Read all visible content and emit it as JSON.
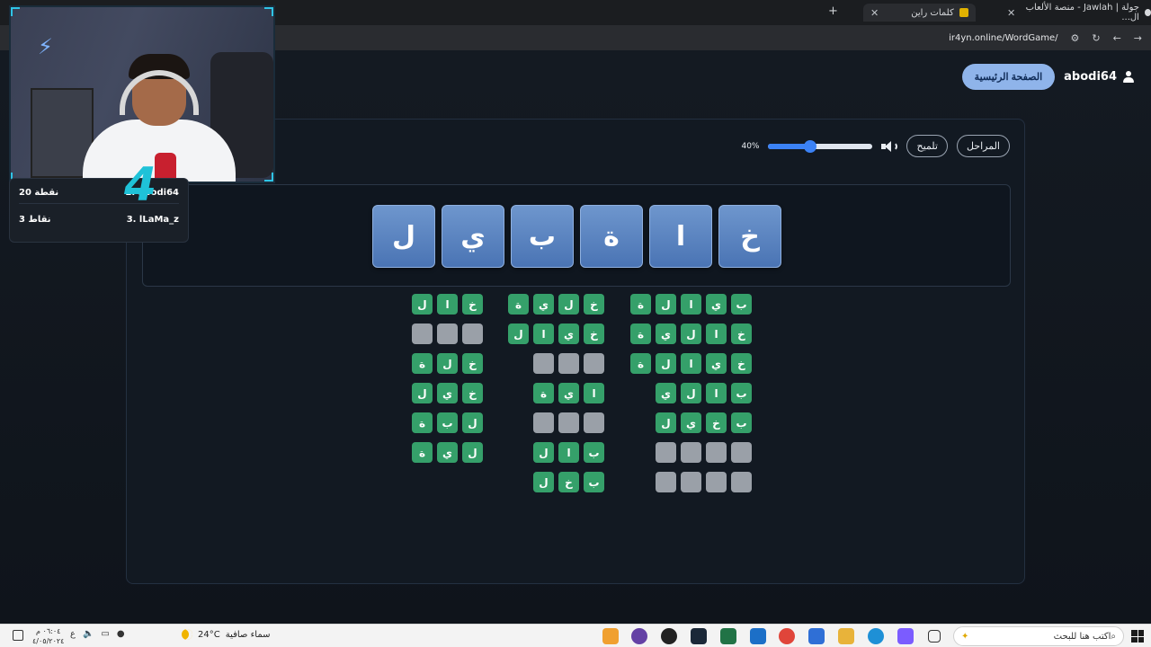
{
  "browser": {
    "tabs": [
      {
        "title": "جولة | Jawlah - منصة الألعاب ال...",
        "active": false
      },
      {
        "title": "كلمات راين",
        "active": true
      }
    ],
    "new_tab": "+",
    "url": "ir4yn.online/WordGame/"
  },
  "header": {
    "username": "abodi64",
    "home_button": "الصفحة الرئيسية"
  },
  "controls": {
    "stages_button": "المراحل",
    "hint_button": "تلميح",
    "volume_percent": 40,
    "volume_label": "40%"
  },
  "letters": [
    "خ",
    "ا",
    "ة",
    "ب",
    "ي",
    "ل"
  ],
  "word_columns": [
    [
      {
        "letters": [
          "ب",
          "ي",
          "ا",
          "ل",
          "ة"
        ],
        "found": true
      },
      {
        "letters": [
          "خ",
          "ا",
          "ل",
          "ي",
          "ة"
        ],
        "found": true
      },
      {
        "letters": [
          "خ",
          "ي",
          "ا",
          "ل",
          "ة"
        ],
        "found": true
      },
      {
        "letters": [
          "ب",
          "ا",
          "ل",
          "ي"
        ],
        "found": true
      },
      {
        "letters": [
          "ب",
          "خ",
          "ي",
          "ل"
        ],
        "found": true
      },
      {
        "letters": [
          "",
          "",
          "",
          ""
        ],
        "found": false
      },
      {
        "letters": [
          "",
          "",
          "",
          ""
        ],
        "found": false
      }
    ],
    [
      {
        "letters": [
          "خ",
          "ل",
          "ي",
          "ة"
        ],
        "found": true
      },
      {
        "letters": [
          "خ",
          "ي",
          "ا",
          "ل"
        ],
        "found": true
      },
      {
        "letters": [
          "",
          "",
          ""
        ],
        "found": false
      },
      {
        "letters": [
          "ا",
          "ي",
          "ة"
        ],
        "found": true
      },
      {
        "letters": [
          "",
          "",
          ""
        ],
        "found": false
      },
      {
        "letters": [
          "ب",
          "ا",
          "ل"
        ],
        "found": true
      },
      {
        "letters": [
          "ب",
          "خ",
          "ل"
        ],
        "found": true
      }
    ],
    [
      {
        "letters": [
          "خ",
          "ا",
          "ل"
        ],
        "found": true
      },
      {
        "letters": [
          "",
          "",
          ""
        ],
        "found": false
      },
      {
        "letters": [
          "خ",
          "ل",
          "ة"
        ],
        "found": true
      },
      {
        "letters": [
          "خ",
          "ي",
          "ل"
        ],
        "found": true
      },
      {
        "letters": [
          "ل",
          "ب",
          "ة"
        ],
        "found": true
      },
      {
        "letters": [
          "ل",
          "ي",
          "ة"
        ],
        "found": true
      }
    ]
  ],
  "scoreboard": [
    {
      "rank_name": "2. abodi64",
      "points": "20 نقطة"
    },
    {
      "rank_name": "3. lLaMa_z",
      "points": "3 نقاط"
    }
  ],
  "stream_badge": "4",
  "taskbar": {
    "search_placeholder": "اكتب هنا للبحث",
    "weather_text": "سماء صافية",
    "temperature": "24°C",
    "time": "٠٦:٠٤ م",
    "date": "٤/٠٥/٢٠٢٤",
    "lang": "ع"
  },
  "colors": {
    "letter_tile": "#5a84c2",
    "found_cell": "#35a06a",
    "empty_cell": "#9aa0a8",
    "home_button": "#8fb4ea",
    "slider": "#3b82f6"
  }
}
